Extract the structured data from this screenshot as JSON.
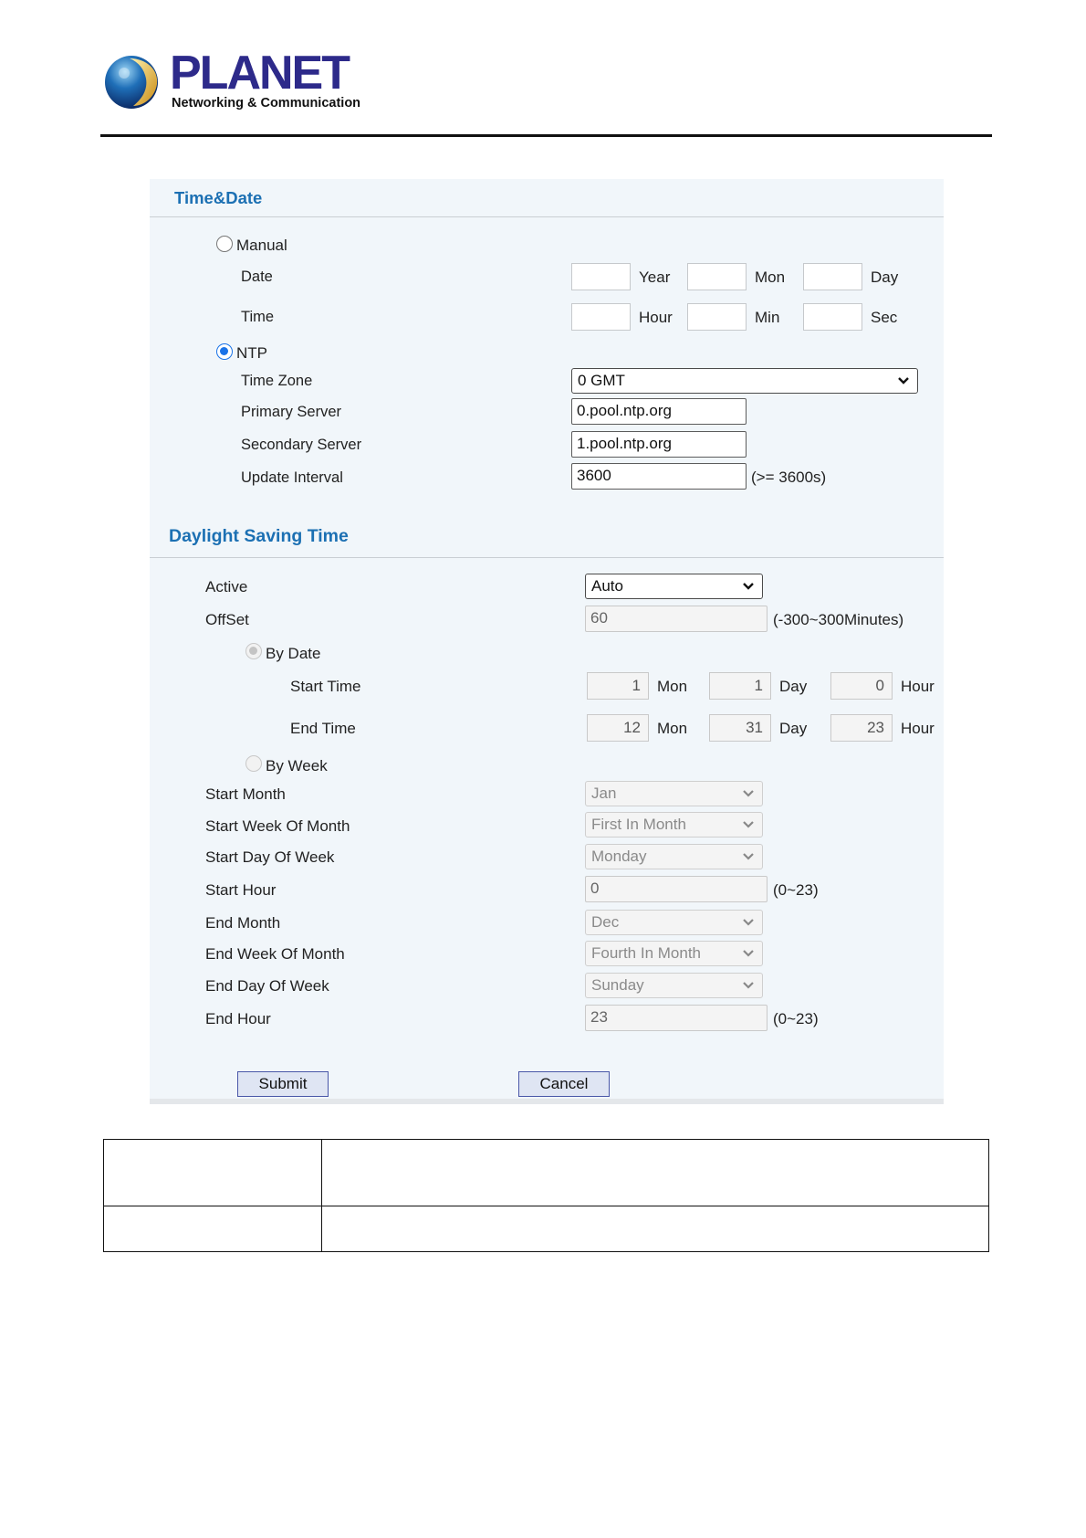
{
  "brand": {
    "name": "PLANET",
    "tagline": "Networking & Communication"
  },
  "time_date": {
    "title": "Time&Date",
    "manual": {
      "label": "Manual",
      "selected": false
    },
    "date": {
      "label": "Date",
      "units": [
        "Year",
        "Mon",
        "Day"
      ]
    },
    "time": {
      "label": "Time",
      "units": [
        "Hour",
        "Min",
        "Sec"
      ]
    },
    "ntp": {
      "label": "NTP",
      "selected": true
    },
    "time_zone": {
      "label": "Time Zone",
      "value": "0 GMT"
    },
    "primary_server": {
      "label": "Primary Server",
      "value": "0.pool.ntp.org"
    },
    "secondary_server": {
      "label": "Secondary Server",
      "value": "1.pool.ntp.org"
    },
    "update_interval": {
      "label": "Update Interval",
      "value": "3600",
      "hint": "(>= 3600s)"
    }
  },
  "dst": {
    "title": "Daylight Saving Time",
    "active": {
      "label": "Active",
      "value": "Auto"
    },
    "offset": {
      "label": "OffSet",
      "value": "60",
      "hint": "(-300~300Minutes)"
    },
    "by_date": {
      "label": "By Date"
    },
    "start_time": {
      "label": "Start Time",
      "mon": "1",
      "day": "1",
      "hour": "0"
    },
    "end_time": {
      "label": "End Time",
      "mon": "12",
      "day": "31",
      "hour": "23"
    },
    "units": {
      "mon": "Mon",
      "day": "Day",
      "hour": "Hour"
    },
    "by_week": {
      "label": "By Week"
    },
    "start_month": {
      "label": "Start Month",
      "value": "Jan"
    },
    "start_week_of_month": {
      "label": "Start Week Of Month",
      "value": "First In Month"
    },
    "start_day_of_week": {
      "label": "Start Day Of Week",
      "value": "Monday"
    },
    "start_hour": {
      "label": "Start Hour",
      "value": "0",
      "hint": "(0~23)"
    },
    "end_month": {
      "label": "End Month",
      "value": "Dec"
    },
    "end_week_of_month": {
      "label": "End Week Of Month",
      "value": "Fourth In Month"
    },
    "end_day_of_week": {
      "label": "End Day Of Week",
      "value": "Sunday"
    },
    "end_hour": {
      "label": "End Hour",
      "value": "23",
      "hint": "(0~23)"
    }
  },
  "buttons": {
    "submit": "Submit",
    "cancel": "Cancel"
  }
}
